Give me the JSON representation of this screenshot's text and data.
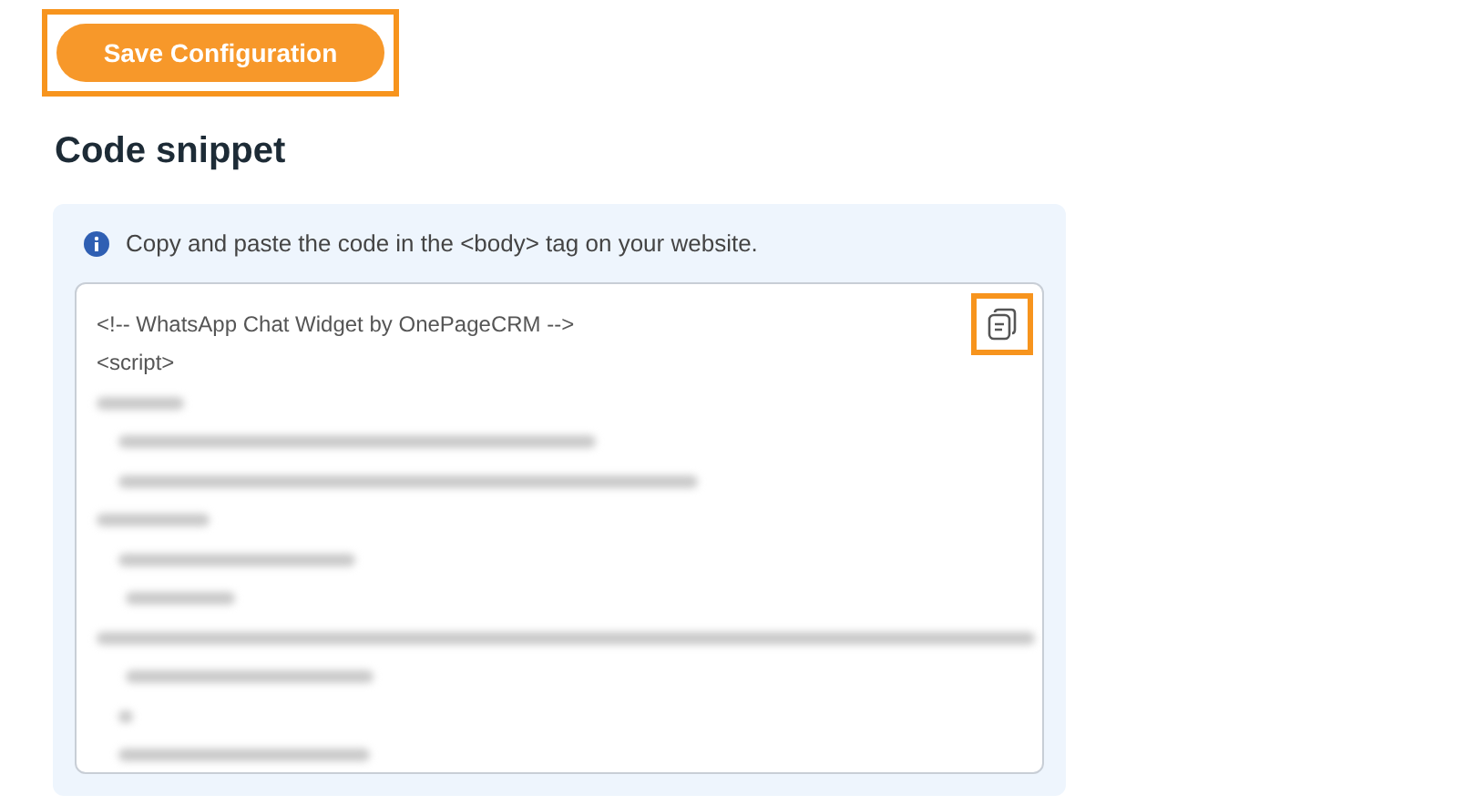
{
  "save_button": {
    "label": "Save Configuration",
    "highlighted": true
  },
  "section": {
    "title": "Code snippet"
  },
  "info": {
    "text": "Copy and paste the code in the <body> tag on your website."
  },
  "code": {
    "lines": [
      "<!-- WhatsApp Chat Widget by OnePageCRM -->",
      "<script>"
    ]
  },
  "copy_button": {
    "highlighted": true
  }
}
